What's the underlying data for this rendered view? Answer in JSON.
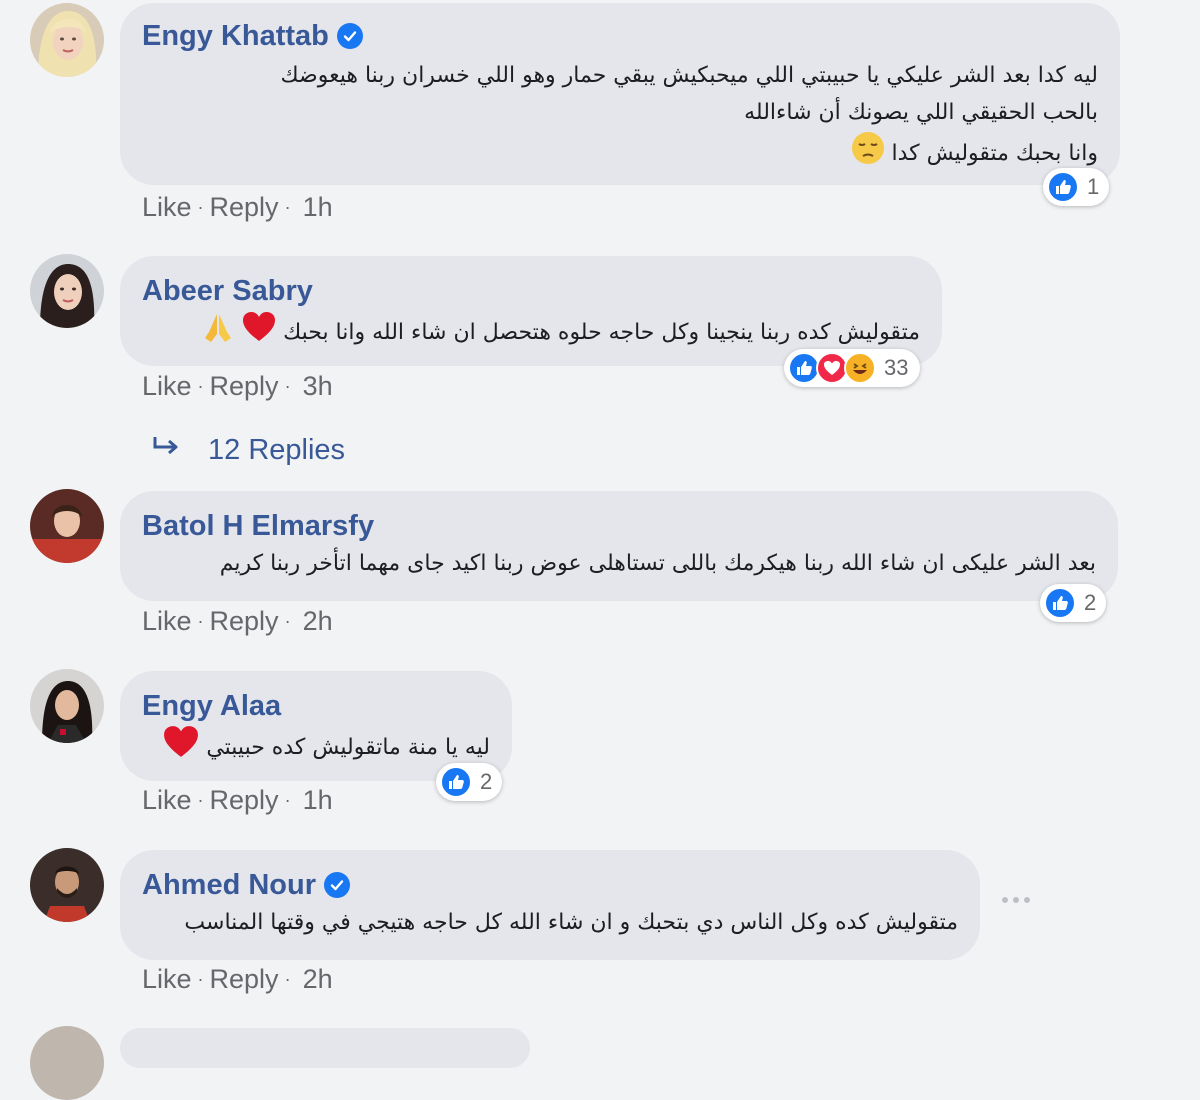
{
  "comments": [
    {
      "author": "Engy Khattab",
      "verified": true,
      "lines": [
        "ليه كدا بعد الشر عليكي يا حبيبتي اللي ميحبكيش يبقي حمار وهو اللي خسران ربنا هيعوضك",
        "بالحب الحقيقي اللي يصونك أن شاءالله",
        "وانا بحبك متقوليش كدا"
      ],
      "emoji": "pensive-face",
      "actions": {
        "like": "Like",
        "reply": "Reply",
        "time": "1h"
      },
      "reaction_count": "1",
      "reactions": [
        "like-icon"
      ]
    },
    {
      "author": "Abeer Sabry",
      "verified": false,
      "lines": [
        "متقوليش كده ربنا ينجينا وكل حاجه حلوه هتحصل ان شاء الله وانا بحبك"
      ],
      "emoji": "heart-and-pray",
      "actions": {
        "like": "Like",
        "reply": "Reply",
        "time": "3h"
      },
      "reaction_count": "33",
      "reactions": [
        "like-icon",
        "love-icon",
        "haha-icon"
      ]
    },
    {
      "author": "Batol H Elmarsfy",
      "verified": false,
      "lines": [
        "بعد الشر عليكى ان شاء الله ربنا هيكرمك باللى تستاهلى عوض ربنا اكيد جاى مهما اتأخر ربنا كريم"
      ],
      "actions": {
        "like": "Like",
        "reply": "Reply",
        "time": "2h"
      },
      "reaction_count": "2",
      "reactions": [
        "like-icon"
      ]
    },
    {
      "author": "Engy Alaa",
      "verified": false,
      "lines": [
        "ليه يا منة ماتقوليش كده حبيبتي"
      ],
      "emoji": "red-heart",
      "actions": {
        "like": "Like",
        "reply": "Reply",
        "time": "1h"
      },
      "reaction_count": "2",
      "reactions": [
        "like-icon"
      ]
    },
    {
      "author": "Ahmed Nour",
      "verified": true,
      "lines": [
        "متقوليش كده وكل الناس دي بتحبك و ان شاء الله كل حاجه هتيجي في وقتها المناسب"
      ],
      "actions": {
        "like": "Like",
        "reply": "Reply",
        "time": "2h"
      }
    }
  ],
  "replies_link": {
    "label": "12 Replies",
    "icon": "reply-arrow-icon"
  },
  "colors": {
    "author": "#385898",
    "bubble": "#e4e6eb",
    "background": "#f2f3f5",
    "like": "#1877f2",
    "love": "#f0284a",
    "haha": "#f7b125"
  }
}
